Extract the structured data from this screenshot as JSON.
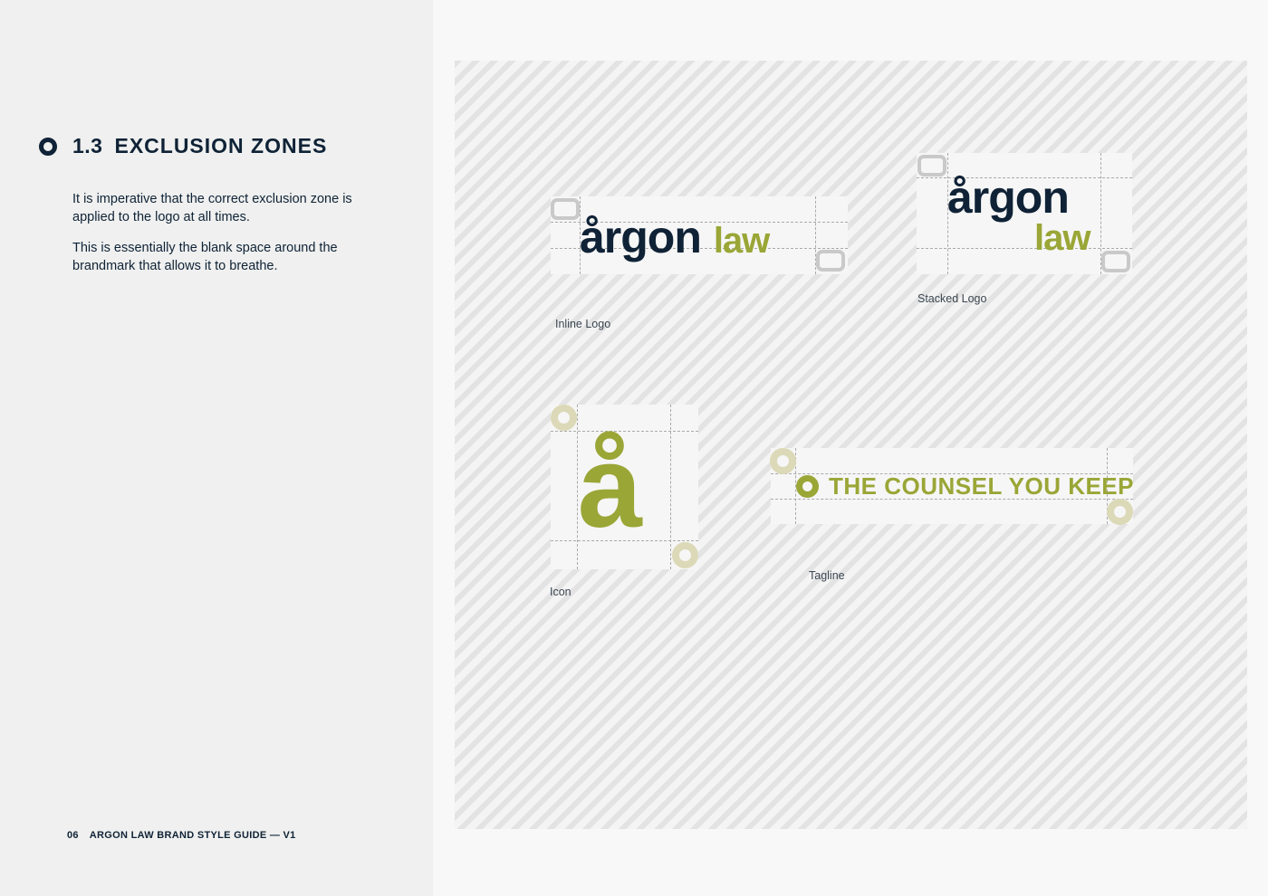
{
  "section": {
    "number": "1.3",
    "title": "EXCLUSION ZONES",
    "paragraphs": [
      "It is imperative that the correct exclusion zone is applied to the logo at all times.",
      "This is essentially the blank space around the brandmark that allows it to breathe."
    ]
  },
  "footer": {
    "page_number": "06",
    "title": "ARGON LAW BRAND STYLE GUIDE — V1"
  },
  "logos": {
    "inline": {
      "word1": "årgon",
      "word2": "law",
      "caption": "Inline Logo"
    },
    "stacked": {
      "word1": "årgon",
      "word2": "law",
      "caption": "Stacked Logo"
    },
    "icon": {
      "glyph": "å",
      "caption": "Icon"
    },
    "tagline": {
      "text": "THE COUNSEL YOU KEEP",
      "caption": "Tagline"
    }
  },
  "colors": {
    "navy": "#0f2236",
    "green": "#9aa636",
    "left_panel": "#eff0ef",
    "marker_grey": "#c9c9c9",
    "marker_khaki": "#dcd9b8"
  },
  "icons": {
    "heading_bullet": "ring-bullet-icon",
    "zone_marker_square": "rounded-square-marker-icon",
    "zone_marker_circle": "ring-marker-icon",
    "tagline_bullet": "ring-bullet-icon"
  }
}
